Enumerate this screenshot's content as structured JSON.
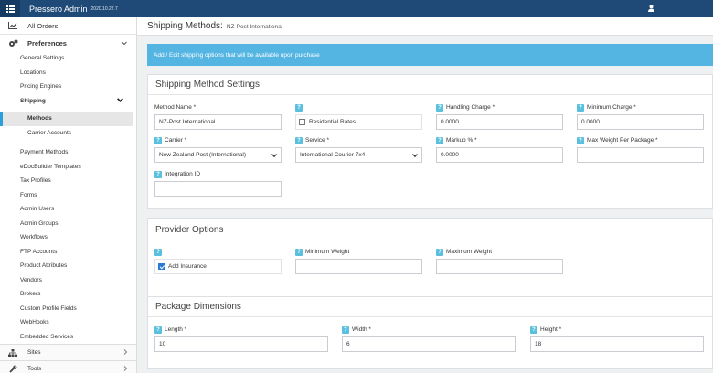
{
  "app": {
    "title": "Pressero Admin",
    "version": "2020.10.22.7"
  },
  "sidebar": {
    "all_orders": "All Orders",
    "preferences": "Preferences",
    "pref_items": [
      "General Settings",
      "Locations",
      "Pricing Engines"
    ],
    "shipping": "Shipping",
    "shipping_items": {
      "methods": "Methods",
      "carrier_accounts": "Carrier Accounts"
    },
    "more_items": [
      "Payment Methods",
      "eDocBuilder Templates",
      "Tax Profiles",
      "Forms",
      "Admin Users",
      "Admin Groups",
      "Workflows",
      "FTP Accounts",
      "Product Attributes",
      "Vendors",
      "Brokers",
      "Custom Profile Fields",
      "WebHooks",
      "Embedded Services"
    ],
    "sites": "Sites",
    "tools": "Tools"
  },
  "header": {
    "title": "Shipping Methods:",
    "subtitle": "NZ-Post International"
  },
  "banner": "Add / Edit shipping options that will be available upon purchase",
  "settings": {
    "title": "Shipping Method Settings",
    "method_name_label": "Method Name *",
    "method_name_value": "NZ-Post International",
    "residential_label": "Residential Rates",
    "handling_label": "Handling Charge *",
    "handling_value": "0.0000",
    "min_charge_label": "Minimum Charge *",
    "min_charge_value": "0.0000",
    "carrier_label": "Carrier *",
    "carrier_value": "New Zealand Post (International)",
    "service_label": "Service *",
    "service_value": "International Courier 7x4",
    "markup_label": "Markup % *",
    "markup_value": "0.0000",
    "max_weight_label": "Max Weight Per Package *",
    "max_weight_value": "",
    "integration_label": "Integration ID",
    "integration_value": ""
  },
  "provider": {
    "title": "Provider Options",
    "insurance_label": "Add Insurance",
    "min_weight_label": "Minimum Weight",
    "min_weight_value": "",
    "max_weight_label": "Maximum Weight",
    "max_weight_value": ""
  },
  "package": {
    "title": "Package Dimensions",
    "length_label": "Length *",
    "length_value": "10",
    "width_label": "Width *",
    "width_value": "6",
    "height_label": "Height *",
    "height_value": "18"
  },
  "icons": {
    "help": "?"
  }
}
